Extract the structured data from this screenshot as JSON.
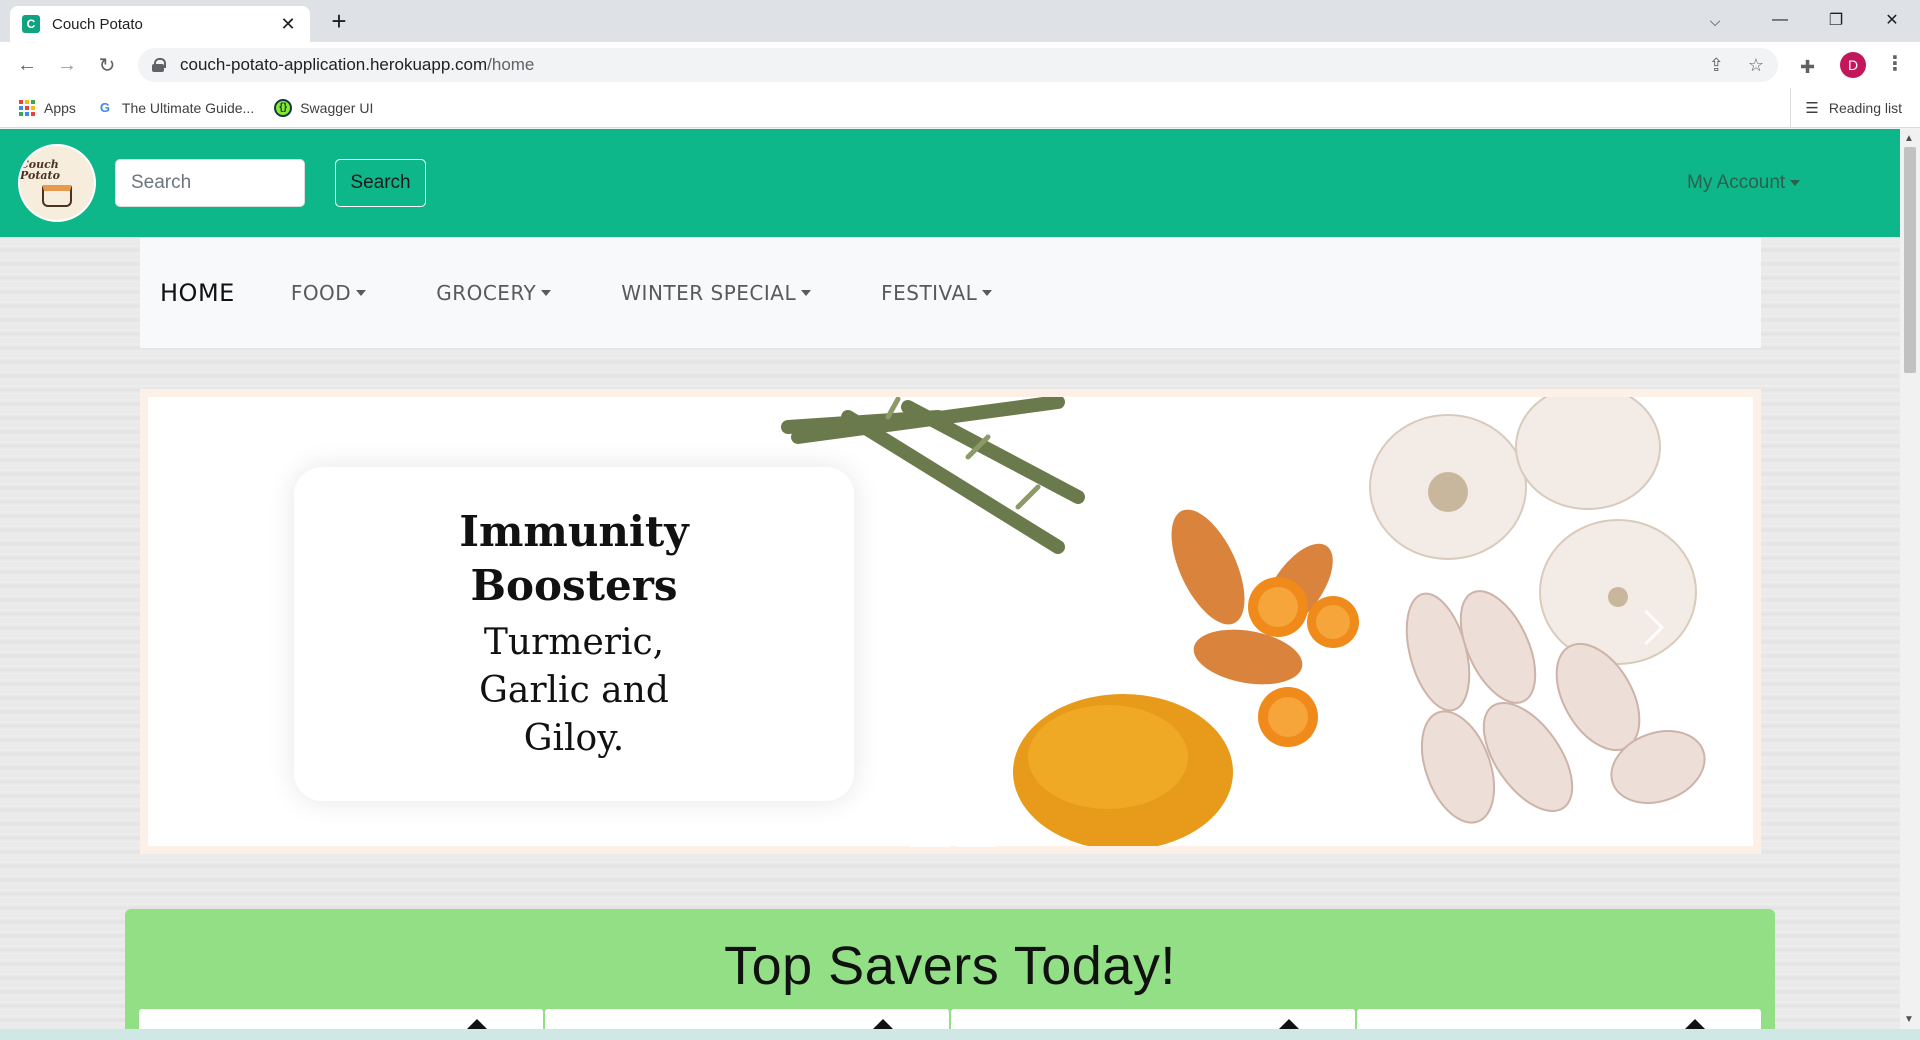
{
  "browser": {
    "tab_title": "Couch Potato",
    "tab_favicon_letter": "C",
    "url_host": "couch-potato-application.herokuapp.com",
    "url_path": "/home",
    "profile_initial": "D",
    "bookmarks": [
      {
        "label": "Apps",
        "icon": "apps-grid-icon"
      },
      {
        "label": "The Ultimate Guide...",
        "icon": "google-icon"
      },
      {
        "label": "Swagger UI",
        "icon": "swagger-icon"
      }
    ],
    "reading_list": "Reading list"
  },
  "header": {
    "logo_text": "Couch Potato",
    "search_placeholder": "Search",
    "search_button": "Search",
    "account_label": "My Account",
    "brand_color": "#0db78a"
  },
  "menu": {
    "home": "HOME",
    "items": [
      "FOOD",
      "GROCERY",
      "WINTER SPECIAL",
      "FESTIVAL"
    ]
  },
  "carousel": {
    "title": "Immunity Boosters",
    "subtitle": "Turmeric, Garlic and Giloy."
  },
  "savers": {
    "title": "Top Savers Today!",
    "color": "#92df86"
  }
}
